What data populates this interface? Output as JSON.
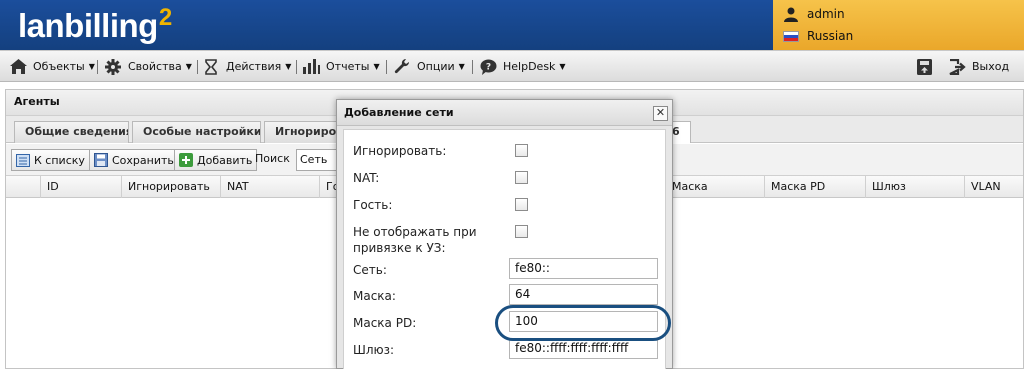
{
  "app": {
    "logo": "lanbilling",
    "logo_sup": "2"
  },
  "user": {
    "name": "admin",
    "language": "Russian"
  },
  "menu": {
    "items": [
      {
        "label": "Объекты",
        "icon": "building-icon"
      },
      {
        "label": "Свойства",
        "icon": "gear-icon"
      },
      {
        "label": "Действия",
        "icon": "hourglass-icon"
      },
      {
        "label": "Отчеты",
        "icon": "bar-chart-icon"
      },
      {
        "label": "Опции",
        "icon": "wrench-icon"
      },
      {
        "label": "HelpDesk",
        "icon": "chat-icon"
      }
    ],
    "exit_label": "Выход"
  },
  "panel": {
    "title": "Агенты",
    "tabs": [
      "Общие сведения",
      "Особые настройки",
      "Игнорирова",
      "6"
    ],
    "toolbar": {
      "back_label": "К списку",
      "save_label": "Сохранить",
      "add_label": "Добавить",
      "search_label": "Поиск",
      "search_value": "Сеть"
    },
    "columns": [
      "ID",
      "Игнорировать",
      "NAT",
      "Го",
      "Маска",
      "Маска PD",
      "Шлюз",
      "VLAN"
    ]
  },
  "modal": {
    "title": "Добавление сети",
    "fields": {
      "ignore_label": "Игнорировать:",
      "nat_label": "NAT:",
      "guest_label": "Гость:",
      "hide_label": "Не отображать при привязке к УЗ:",
      "network_label": "Сеть:",
      "network_value": "fe80::",
      "mask_label": "Маска:",
      "mask_value": "64",
      "mask_pd_label": "Маска PD:",
      "mask_pd_value": "100",
      "gateway_label": "Шлюз:",
      "gateway_value": "fe80::ffff:ffff:ffff:ffff"
    }
  },
  "colors": {
    "header_blue": "#1b4e9c",
    "user_panel": "#f0b43a",
    "highlight": "#1a4f80"
  }
}
